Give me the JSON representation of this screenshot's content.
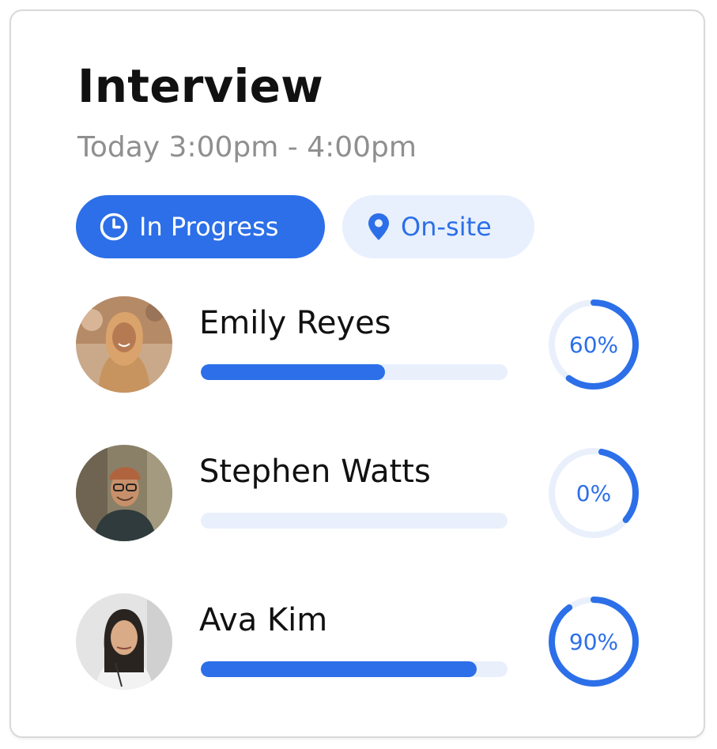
{
  "card": {
    "title": "Interview",
    "time": "Today 3:00pm - 4:00pm"
  },
  "tags": {
    "status": {
      "label": "In Progress",
      "icon": "clock-icon"
    },
    "location": {
      "label": "On-site",
      "icon": "location-pin-icon"
    }
  },
  "colors": {
    "accent": "#2c6fe8",
    "accent_light": "#e8f0fd",
    "track": "#e9f0fc",
    "subtitle": "#8f8f8f"
  },
  "candidates": [
    {
      "name": "Emily Reyes",
      "progress": 60,
      "progress_label": "60%"
    },
    {
      "name": "Stephen Watts",
      "progress": 0,
      "progress_label": "0%"
    },
    {
      "name": "Ava Kim",
      "progress": 90,
      "progress_label": "90%"
    }
  ]
}
